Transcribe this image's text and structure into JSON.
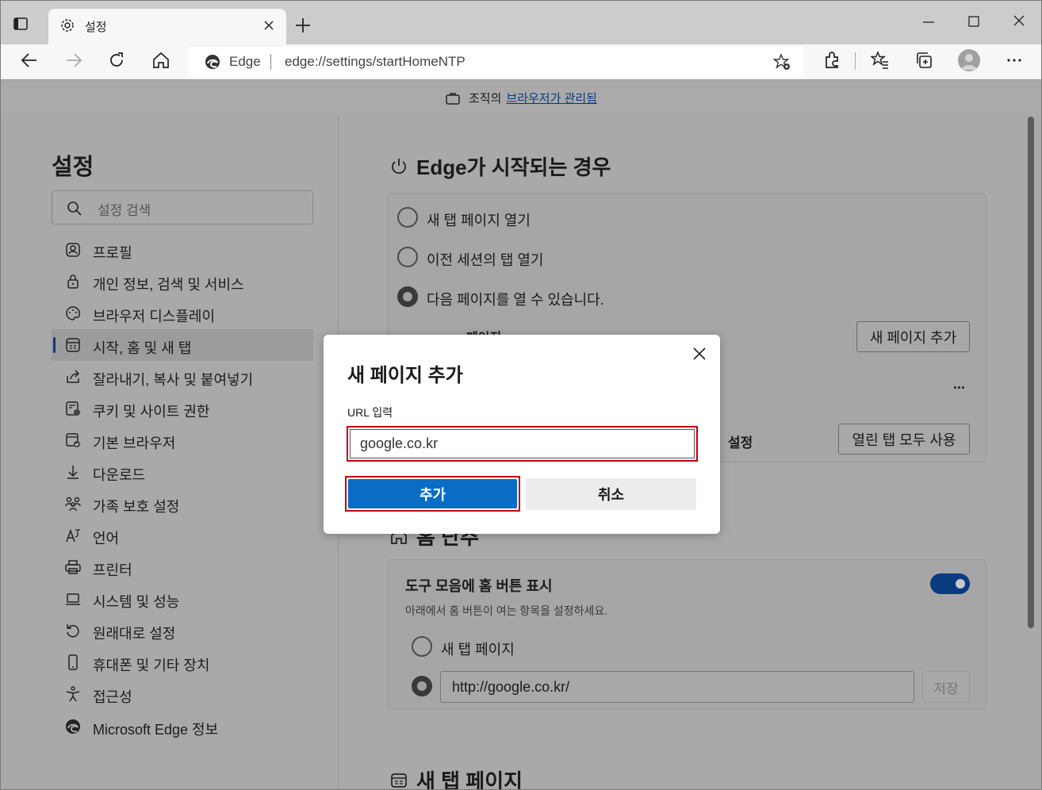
{
  "browser": {
    "tab_title": "설정",
    "address_label": "Edge",
    "address_url": "edge://settings/startHomeNTP"
  },
  "managed_bar": {
    "text": "조직의",
    "link": "브라우저가 관리됨"
  },
  "sidebar": {
    "title": "설정",
    "search_placeholder": "설정 검색",
    "items": [
      {
        "label": "프로필",
        "icon": "profile-icon"
      },
      {
        "label": "개인 정보, 검색 및 서비스",
        "icon": "lock-icon"
      },
      {
        "label": "브라우저 디스플레이",
        "icon": "palette-icon"
      },
      {
        "label": "시작, 홈 및 새 탭",
        "icon": "start-home-icon"
      },
      {
        "label": "잘라내기, 복사 및 붙여넣기",
        "icon": "share-icon"
      },
      {
        "label": "쿠키 및 사이트 권한",
        "icon": "cookie-icon"
      },
      {
        "label": "기본 브라우저",
        "icon": "default-browser-icon"
      },
      {
        "label": "다운로드",
        "icon": "download-icon"
      },
      {
        "label": "가족 보호 설정",
        "icon": "family-icon"
      },
      {
        "label": "언어",
        "icon": "language-icon"
      },
      {
        "label": "프린터",
        "icon": "printer-icon"
      },
      {
        "label": "시스템 및 성능",
        "icon": "laptop-icon"
      },
      {
        "label": "원래대로 설정",
        "icon": "reset-icon"
      },
      {
        "label": "휴대폰 및 기타 장치",
        "icon": "phone-icon"
      },
      {
        "label": "접근성",
        "icon": "accessibility-icon"
      },
      {
        "label": "Microsoft Edge 정보",
        "icon": "edge-icon"
      }
    ]
  },
  "main": {
    "startup": {
      "title": "Edge가 시작되는 경우",
      "options": [
        "새 탭 페이지 열기",
        "이전 세션의 탭 열기",
        "다음 페이지를 열 수 있습니다."
      ],
      "pages_label": "페이지",
      "add_page_button": "새 페이지 추가",
      "more": "...",
      "settings_label": "설정",
      "use_all_tabs_button": "열린 탭 모두 사용"
    },
    "home": {
      "title": "홈 단추",
      "show_home_label": "도구 모음에 홈 버튼 표시",
      "show_home_desc": "아래에서 홈 버튼이 여는 항목을 설정하세요.",
      "option_newtab": "새 탭 페이지",
      "url_value": "http://google.co.kr/",
      "save_button": "저장"
    },
    "newtab": {
      "title": "새 탭 페이지"
    }
  },
  "dialog": {
    "title": "새 페이지 추가",
    "url_label": "URL 입력",
    "url_value": "google.co.kr",
    "add_button": "추가",
    "cancel_button": "취소"
  },
  "colors": {
    "accent": "#0a6cc4",
    "highlight_border": "#c00010",
    "link": "#0a3a80"
  }
}
